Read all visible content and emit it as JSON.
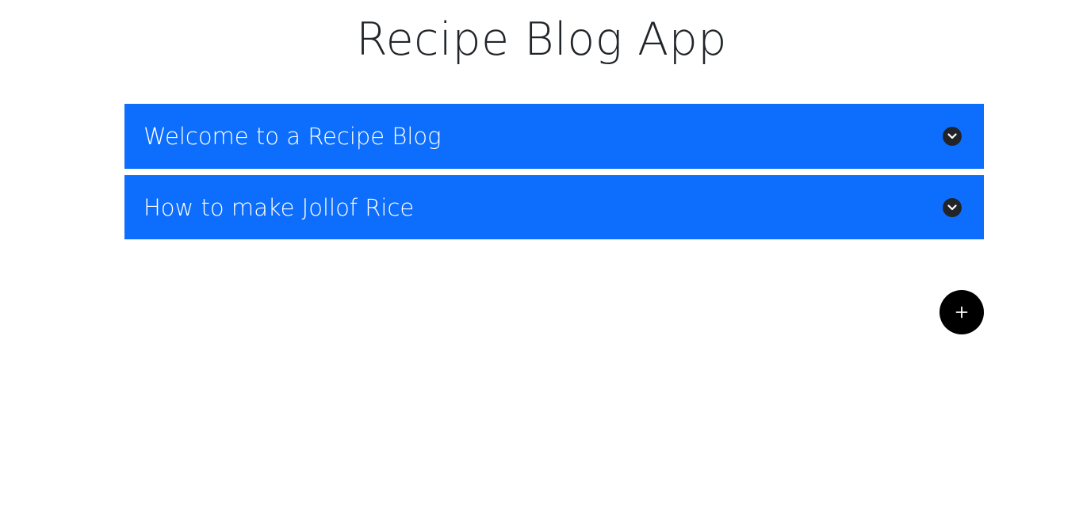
{
  "app": {
    "title": "Recipe Blog App"
  },
  "accordion": {
    "items": [
      {
        "title": "Welcome to a Recipe Blog",
        "icon": "chevron-down-icon"
      },
      {
        "title": "How to make Jollof Rice",
        "icon": "chevron-down-icon"
      }
    ]
  },
  "fab": {
    "icon": "plus-icon"
  },
  "colors": {
    "accent": "#0d6efd",
    "title_text": "#212529",
    "fab_background": "#000000"
  }
}
